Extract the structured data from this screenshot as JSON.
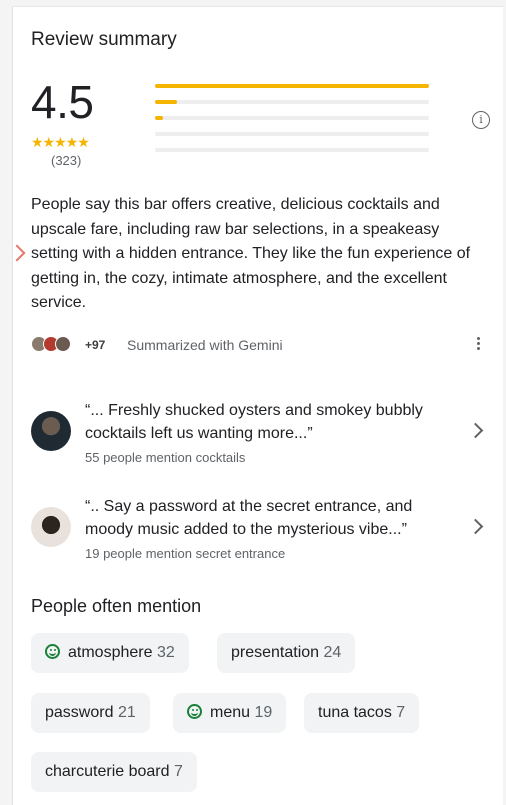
{
  "header": {
    "title": "Review summary"
  },
  "rating": {
    "score": "4.5",
    "stars": "★★★★★",
    "count": "(323)",
    "distribution_fraction": [
      1.0,
      0.08,
      0.03,
      0.0,
      0.0
    ]
  },
  "summary": {
    "text": "People say this bar offers creative, delicious cocktails and upscale fare, including raw bar selections, in a speakeasy setting with a hidden entrance. They like the fun experience of getting in, the cozy, intimate atmosphere, and the excellent service.",
    "plus_count": "+97",
    "gemini_label": "Summarized with Gemini"
  },
  "quotes": [
    {
      "text": "“... Freshly shucked oysters and smokey bubbly cocktails left us wanting more...”",
      "mention": "55 people mention cocktails"
    },
    {
      "text": "“.. Say a password at the secret entrance, and moody music added to the mysterious vibe...”",
      "mention": "19 people mention secret entrance"
    }
  ],
  "often": {
    "title": "People often mention",
    "chips": [
      {
        "label": "atmosphere",
        "count": "32",
        "positive": true
      },
      {
        "label": "presentation",
        "count": "24",
        "positive": false
      },
      {
        "label": "password",
        "count": "21",
        "positive": false
      },
      {
        "label": "menu",
        "count": "19",
        "positive": true
      },
      {
        "label": "tuna tacos",
        "count": "7",
        "positive": false
      },
      {
        "label": "charcuterie board",
        "count": "7",
        "positive": false
      }
    ]
  },
  "colors": {
    "star": "#f4b400",
    "positive": "#188038",
    "chip_bg": "#f1f3f4"
  },
  "icons": [
    "info-icon",
    "more-vert-icon",
    "chevron-right-icon",
    "smiley-icon"
  ]
}
